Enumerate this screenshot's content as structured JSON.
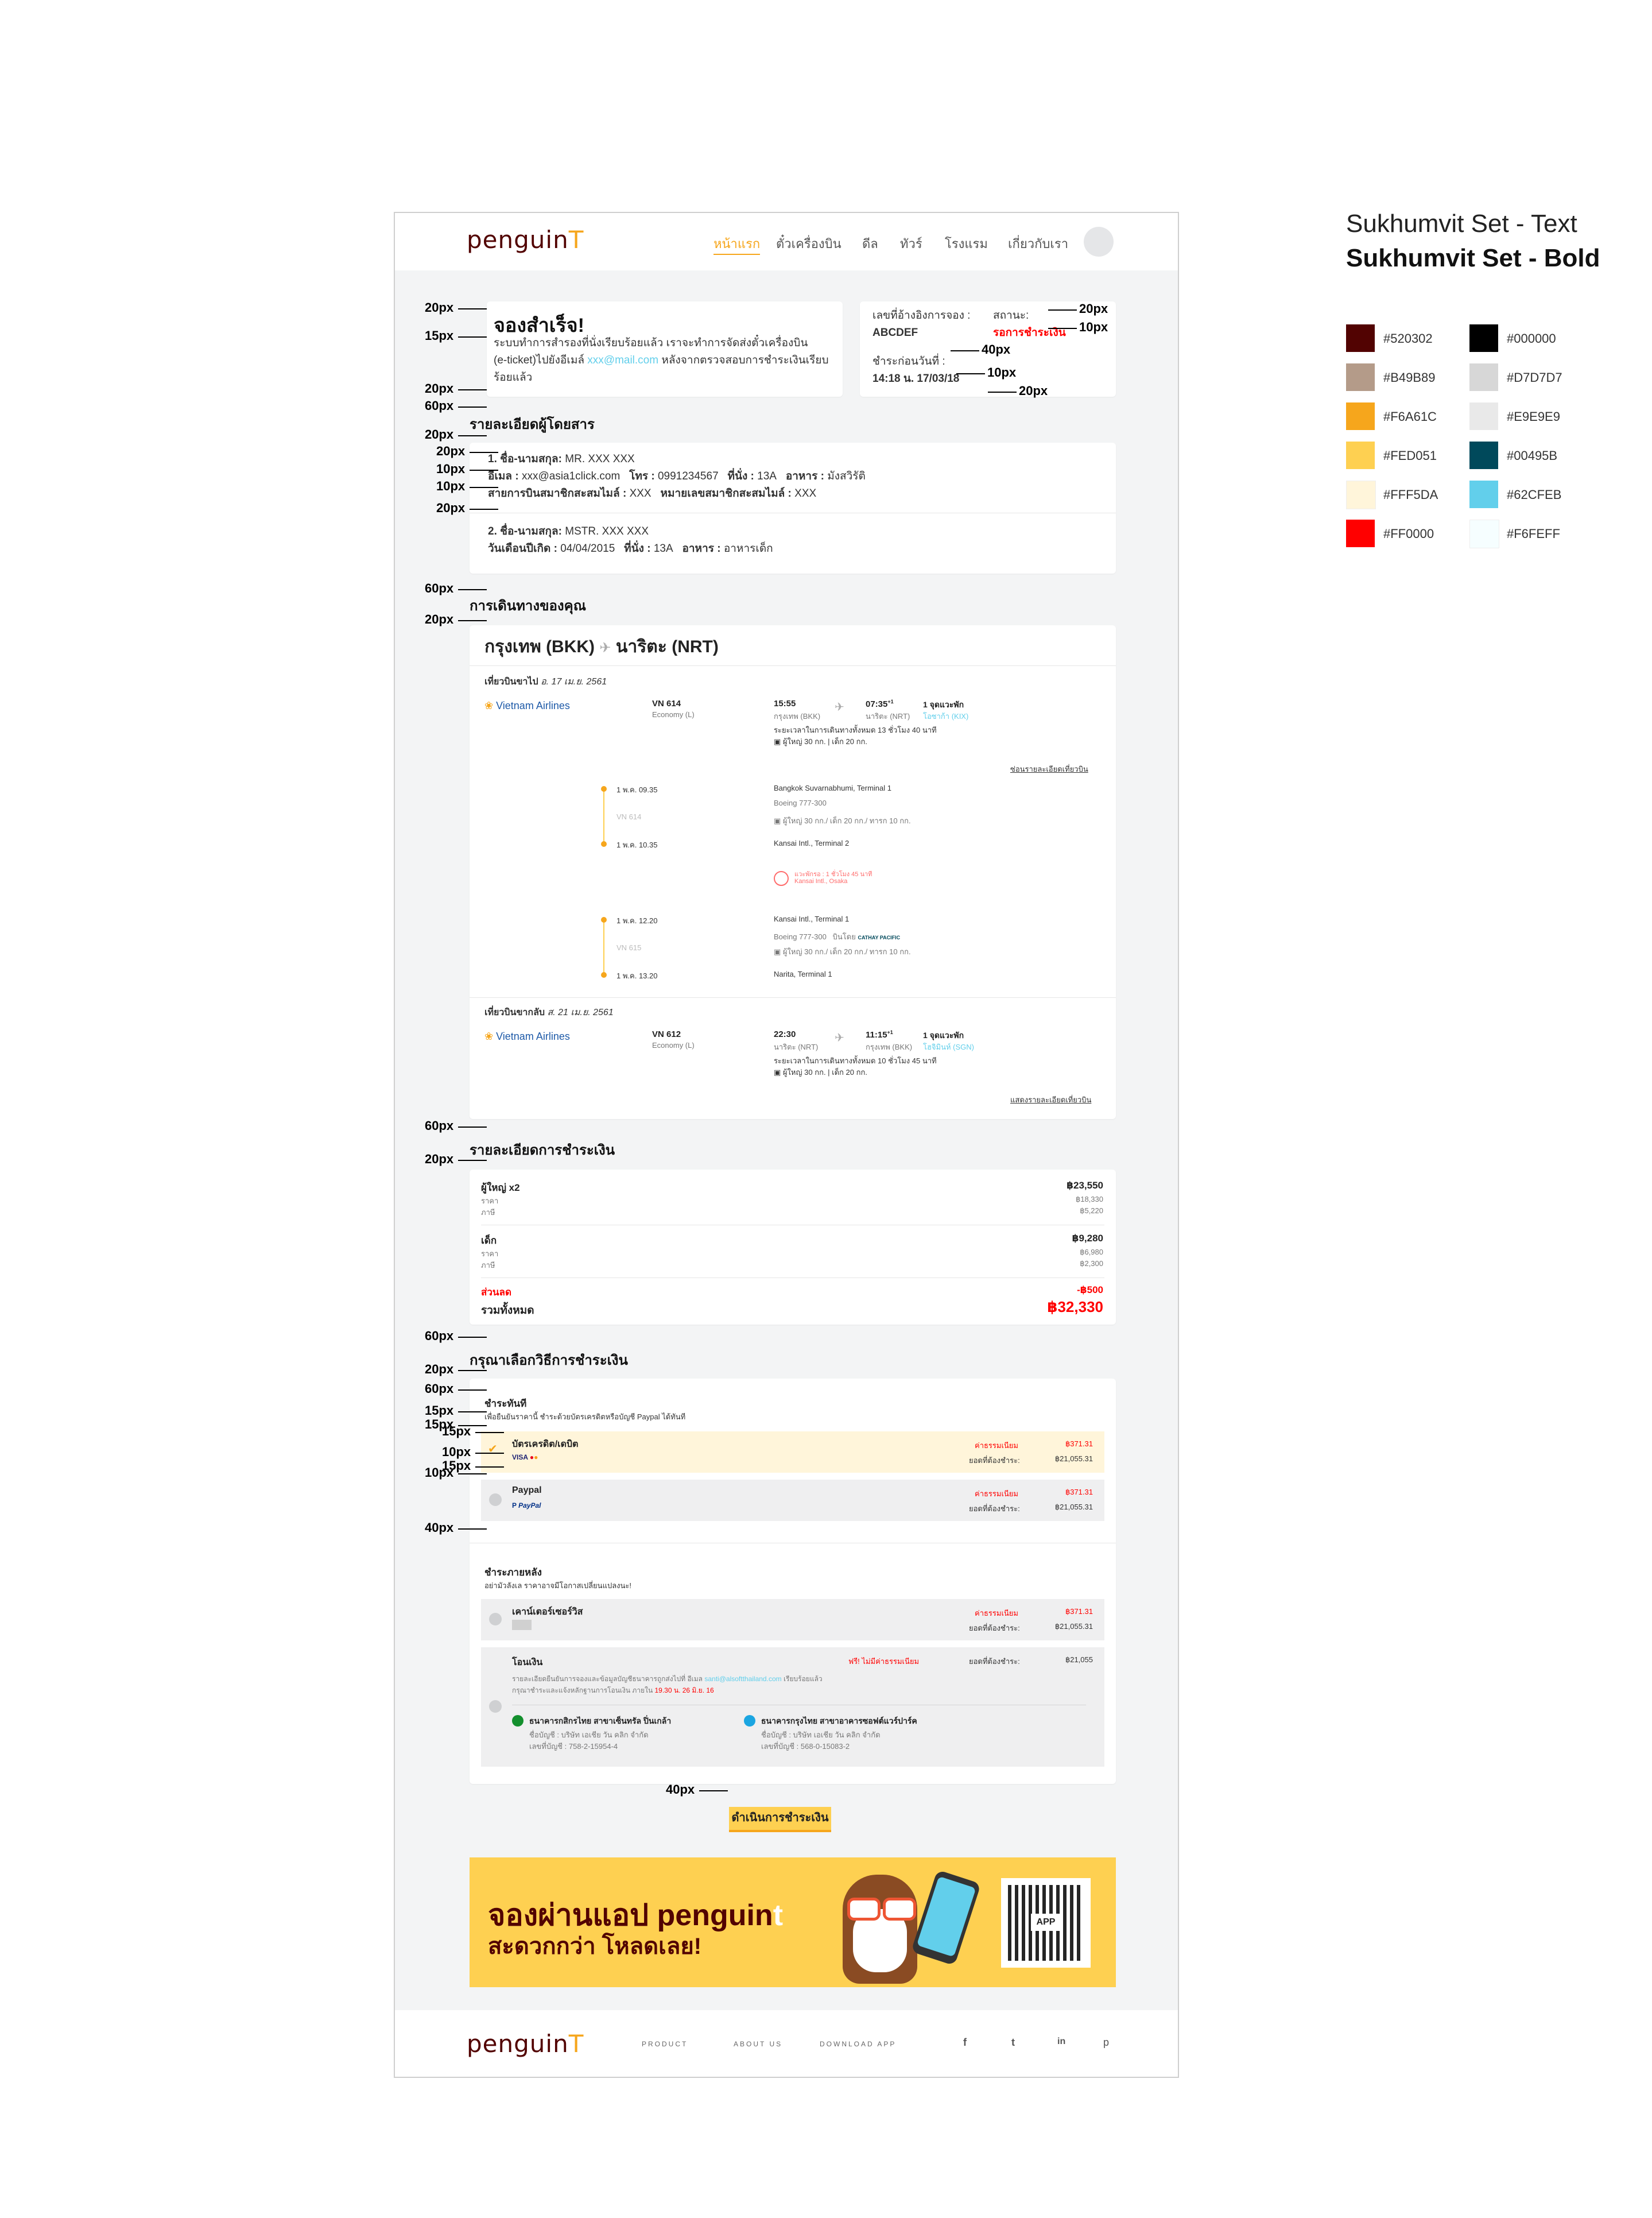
{
  "fonts": {
    "text": "Sukhumvit Set - Text",
    "bold": "Sukhumvit Set - Bold"
  },
  "palette": [
    {
      "hex": "#520302",
      "label": "#520302"
    },
    {
      "hex": "#000000",
      "label": "#000000"
    },
    {
      "hex": "#B49B89",
      "label": "#B49B89"
    },
    {
      "hex": "#D7D7D7",
      "label": "#D7D7D7"
    },
    {
      "hex": "#F6A61C",
      "label": "#F6A61C"
    },
    {
      "hex": "#E9E9E9",
      "label": "#E9E9E9"
    },
    {
      "hex": "#FED051",
      "label": "#FED051"
    },
    {
      "hex": "#00495B",
      "label": "#00495B"
    },
    {
      "hex": "#FFF5DA",
      "label": "#FFF5DA"
    },
    {
      "hex": "#62CFEB",
      "label": "#62CFEB"
    },
    {
      "hex": "#FF0000",
      "label": "#FF0000"
    },
    {
      "hex": "#F6FEFF",
      "label": "#F6FEFF"
    }
  ],
  "brand": {
    "name": "penguin",
    "suffix": "T"
  },
  "nav": {
    "items": [
      "หน้าแรก",
      "ตั๋วเครื่องบิน",
      "ดีล",
      "ทัวร์",
      "โรงแรม",
      "เกี่ยวกับเรา"
    ]
  },
  "success": {
    "title": "จองสำเร็จ!",
    "line1": "ระบบทำการสำรองที่นั่งเรียบร้อยแล้ว เราจะทำการจัดส่งตั๋วเครื่องบิน",
    "line2_a": "(e-ticket)ไปยังอีเมล์",
    "email": "xxx@mail.com",
    "line2_b": "หลังจากตรวจสอบการชำระเงินเรียบ",
    "line3": "ร้อยแล้ว"
  },
  "booking": {
    "ref_label": "เลขที่อ้างอิงการจอง :",
    "ref_value": "ABCDEF",
    "status_label": "สถานะ:",
    "status_value": "รอการชำระเงิน",
    "deadline_label": "ชำระก่อนวันที่ :",
    "deadline_value": "14:18 น. 17/03/18"
  },
  "passengers": {
    "title": "รายละเอียดผู้โดยสาร",
    "p1": {
      "name_label": "1. ชื่อ-นามสกุล:",
      "name": "MR. XXX XXX",
      "email_label": "อีเมล :",
      "email": "xxx@asia1click.com",
      "phone_label": "โทร :",
      "phone": "0991234567",
      "seat_label": "ที่นั่ง :",
      "seat": "13A",
      "meal_label": "อาหาร :",
      "meal": "มังสวิรัติ",
      "ff_label": "สายการบินสมาชิกสะสมไมล์ :",
      "ff": "XXX",
      "ffno_label": "หมายเลขสมาชิกสะสมไมล์ :",
      "ffno": "XXX"
    },
    "p2": {
      "name_label": "2. ชื่อ-นามสกุล:",
      "name": "MSTR. XXX   XXX",
      "dob_label": "วันเดือนปีเกิด :",
      "dob": "04/04/2015",
      "seat_label": "ที่นั่ง :",
      "seat": "13A",
      "meal_label": "อาหาร :",
      "meal": "อาหารเด็ก"
    }
  },
  "journey": {
    "title": "การเดินทางของคุณ",
    "from": "กรุงเทพ (BKK)",
    "to": "นาริตะ (NRT)",
    "outbound": {
      "label": "เที่ยวบินขาไป",
      "date": "อ. 17 เม.ย. 2561",
      "airline": "Vietnam Airlines",
      "flight": "VN 614",
      "cabin": "Economy (L)",
      "dep_time": "15:55",
      "dep_place": "กรุงเทพ (BKK)",
      "arr_time": "07:35",
      "arr_sup": "+1",
      "arr_place": "นาริตะ (NRT)",
      "stops": "1 จุดแวะพัก",
      "stop_place": "โอซาก้า (KIX)",
      "duration": "ระยะเวลาในการเดินทางทั้งหมด 13 ชั่วโมง 40 นาที",
      "baggage": "ผู้ใหญ่ 30 กก. | เด็ก 20 กก.",
      "hide_link": "ซ่อนรายละเอียดเที่ยวบิน",
      "seg1": {
        "dep_time": "1 พ.ค. 09.35",
        "dep_airport": "Bangkok Suvarnabhumi, Terminal 1",
        "aircraft": "Boeing 777-300",
        "flight": "VN 614",
        "baggage": "ผู้ใหญ่ 30 กก./ เด็ก 20 กก./ ทารก 10 กก.",
        "arr_time": "1 พ.ค. 10.35",
        "arr_airport": "Kansai Intl., Terminal 2"
      },
      "layover": {
        "text": "แวะพักรอ : 1 ชั่วโมง 45 นาที",
        "place": "Kansai Intl., Osaka"
      },
      "seg2": {
        "dep_time": "1 พ.ค. 12.20",
        "dep_airport": "Kansai Intl., Terminal 1",
        "aircraft": "Boeing 777-300",
        "operated": "บินโดย",
        "operator": "CATHAY PACIFIC",
        "flight": "VN 615",
        "baggage": "ผู้ใหญ่ 30 กก./ เด็ก 20 กก./ ทารก 10 กก.",
        "arr_time": "1 พ.ค. 13.20",
        "arr_airport": "Narita, Terminal 1"
      }
    },
    "inbound": {
      "label": "เที่ยวบินขากลับ",
      "date": "ส. 21 เม.ย. 2561",
      "airline": "Vietnam Airlines",
      "flight": "VN 612",
      "cabin": "Economy (L)",
      "dep_time": "22:30",
      "dep_place": "นาริตะ (NRT)",
      "arr_time": "11:15",
      "arr_sup": "+1",
      "arr_place": "กรุงเทพ (BKK)",
      "stops": "1 จุดแวะพัก",
      "stop_place": "โฮจิมินห์ (SGN)",
      "duration": "ระยะเวลาในการเดินทางทั้งหมด 10 ชั่วโมง 45 นาที",
      "baggage": "ผู้ใหญ่ 30 กก. | เด็ก 20 กก.",
      "show_link": "แสดงรายละเอียดเที่ยวบิน"
    }
  },
  "payment": {
    "title": "รายละเอียดการชำระเงิน",
    "adult_label": "ผู้ใหญ่ x2",
    "adult_total": "฿23,550",
    "price_label": "ราคา",
    "adult_price": "฿18,330",
    "tax_label": "ภาษี",
    "adult_tax": "฿5,220",
    "child_label": "เด็ก",
    "child_total": "฿9,280",
    "child_price": "฿6,980",
    "child_tax": "฿2,300",
    "discount_label": "ส่วนลด",
    "discount": "-฿500",
    "total_label": "รวมทั้งหมด",
    "total": "฿32,330"
  },
  "methods": {
    "title": "กรุณาเลือกวิธีการชำระเงิน",
    "now_title": "ชำระทันที",
    "now_sub": "เพื่อยืนยันราคานี้ ชำระด้วยบัตรเครดิตหรือบัญชี Paypal ได้ทันที",
    "card_label": "บัตรเครดิต/เดบิต",
    "fee_label": "ค่าธรรมเนียม",
    "fee": "฿371.31",
    "due_label": "ยอดที่ต้องชำระ:",
    "due": "฿21,055.31",
    "paypal_label": "Paypal",
    "later_title": "ชำระภายหลัง",
    "later_sub": "อย่ามัวลังเล ราคาอาจมีโอกาสเปลี่ยนแปลงนะ!",
    "counter_label": "เคาน์เตอร์เซอร์วิส",
    "transfer_label": "โอนเงิน",
    "transfer_fee": "ฟรี! ไม่มีค่าธรรมเนียม",
    "transfer_due": "฿21,055",
    "transfer_note1_a": "รายละเอียดยืนยันการจองและข้อมูลบัญชีธนาคารถูกส่งไปที่   อีเมล",
    "transfer_email": "santi@alsoftthailand.com",
    "transfer_note1_b": "เรียบร้อยแล้ว",
    "transfer_note2_a": "กรุณาชำระและแจ้งหลักฐานการโอนเงิน ภายใน",
    "transfer_deadline": "19.30 น. 26 มิ.ย. 16",
    "bank1_name": "ธนาคารกสิกรไทย สาขาเซ็นทรัล ปิ่นเกล้า",
    "bank1_acct": "ชื่อบัญชี : บริษัท เอเชีย วัน คลิก จำกัด",
    "bank1_no": "เลขที่บัญชี : 758-2-15954-4",
    "bank2_name": "ธนาคารกรุงไทย สาขาอาคารซอฟต์แวร์ปาร์ค",
    "bank2_acct": "ชื่อบัญชี : บริษัท เอเชีย วัน คลิก จำกัด",
    "bank2_no": "เลขที่บัญชี : 568-0-15083-2",
    "continue": "ดำเนินการชำระเงิน"
  },
  "banner": {
    "line1": "จองผ่านแอป penguin",
    "t": "t",
    "line2": "สะดวกกว่า โหลดเลย!",
    "qr_label": "APP"
  },
  "footer": {
    "links": [
      "PRODUCT",
      "ABOUT US",
      "DOWNLOAD APP"
    ],
    "socials": [
      "f",
      "t",
      "in",
      "p"
    ]
  },
  "dims": {
    "d20": "20px",
    "d15": "15px",
    "d60": "60px",
    "d10": "10px",
    "d40": "40px"
  }
}
